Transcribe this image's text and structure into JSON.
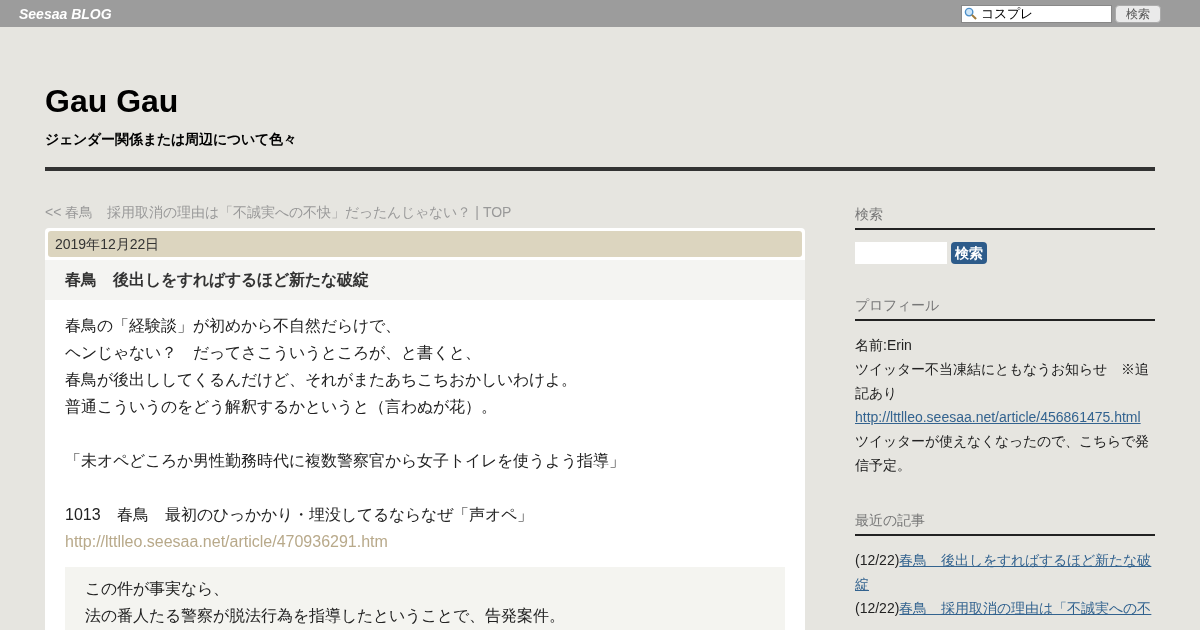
{
  "top_bar": {
    "logo": "Seesaa BLOG",
    "search": {
      "value": "コスプレ",
      "button": "検索"
    }
  },
  "blog": {
    "title": "Gau Gau",
    "subtitle": "ジェンダー関係または周辺について色々"
  },
  "nav": {
    "prev": "<< 春鳥　採用取消の理由は「不誠実への不快」だったんじゃない？",
    "separator": "|",
    "top": "TOP"
  },
  "article": {
    "date": "2019年12月22日",
    "title": "春鳥　後出しをすればするほど新たな破綻",
    "body": [
      {
        "kind": "text",
        "text": "春鳥の「経験談」が初めから不自然だらけで、"
      },
      {
        "kind": "text",
        "text": "ヘンじゃない？　だってさこういうところが、と書くと、"
      },
      {
        "kind": "text",
        "text": "春鳥が後出ししてくるんだけど、それがまたあちこちおかしいわけよ。"
      },
      {
        "kind": "text",
        "text": "普通こういうのをどう解釈するかというと（言わぬが花）。"
      },
      {
        "kind": "blank"
      },
      {
        "kind": "text",
        "text": "「未オペどころか男性勤務時代に複数警察官から女子トイレを使うよう指導」"
      },
      {
        "kind": "blank"
      },
      {
        "kind": "text",
        "text": "1013　春鳥　最初のひっかかり・埋没してるならなぜ「声オペ」"
      },
      {
        "kind": "link",
        "text": "http://lttlleo.seesaa.net/article/470936291.htm"
      },
      {
        "kind": "quote",
        "lines": [
          "この件が事実なら、",
          "法の番人たる警察が脱法行為を指導したということで、告発案件。"
        ]
      }
    ]
  },
  "sidebar": [
    {
      "kind": "search",
      "heading": "検索",
      "button": "検索"
    },
    {
      "kind": "profile",
      "heading": "プロフィール",
      "lines": [
        {
          "kind": "text",
          "text": "名前:Erin"
        },
        {
          "kind": "text",
          "text": "ツイッター不当凍結にともなうお知らせ　※追記あり"
        },
        {
          "kind": "link",
          "text": "http://lttlleo.seesaa.net/article/456861475.html"
        },
        {
          "kind": "text",
          "text": "ツイッターが使えなくなったので、こちらで発信予定。"
        }
      ]
    },
    {
      "kind": "recent",
      "heading": "最近の記事",
      "items": [
        {
          "date": "(12/22)",
          "title": "春鳥　後出しをすればするほど新たな破綻"
        },
        {
          "date": "(12/22)",
          "title": "春鳥　採用取消の理由は「不誠実への不"
        }
      ]
    }
  ]
}
